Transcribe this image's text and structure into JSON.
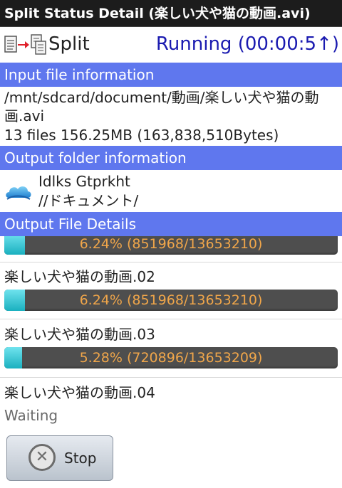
{
  "window": {
    "title": "Split Status Detail (楽しい犬や猫の動画.avi)"
  },
  "operation": {
    "icon": "split-files-icon",
    "name": "Split",
    "status": "Running (00:00:5↑)",
    "status_color": "#1a1ab0"
  },
  "input": {
    "header": "Input file information",
    "path": "/mnt/sdcard/document/動画/楽しい犬や猫の動画.avi",
    "summary": "13 files 156.25MB (163,838,510Bytes)"
  },
  "output": {
    "header": "Output folder information",
    "folder_icon": "skydrive-cloud-icon",
    "account": "Idlks Gtprkht",
    "path": "//ドキュメント/"
  },
  "details": {
    "header": "Output File Details",
    "files": [
      {
        "name": "",
        "progress_text": "6.24% (851968/13653210)",
        "percent": 6.24
      },
      {
        "name": "楽しい犬や猫の動画.02",
        "progress_text": "6.24% (851968/13653210)",
        "percent": 6.24
      },
      {
        "name": "楽しい犬や猫の動画.03",
        "progress_text": "5.28% (720896/13653209)",
        "percent": 5.28
      },
      {
        "name": "楽しい犬や猫の動画.04",
        "status": "Waiting"
      }
    ]
  },
  "actions": {
    "stop_label": "Stop",
    "stop_icon": "cancel-x-icon"
  },
  "colors": {
    "section_header": "#5f77ee",
    "progress_fill": "#1ab0bf",
    "progress_text": "#f0a64a",
    "titlebar": "#1c1c1c"
  }
}
